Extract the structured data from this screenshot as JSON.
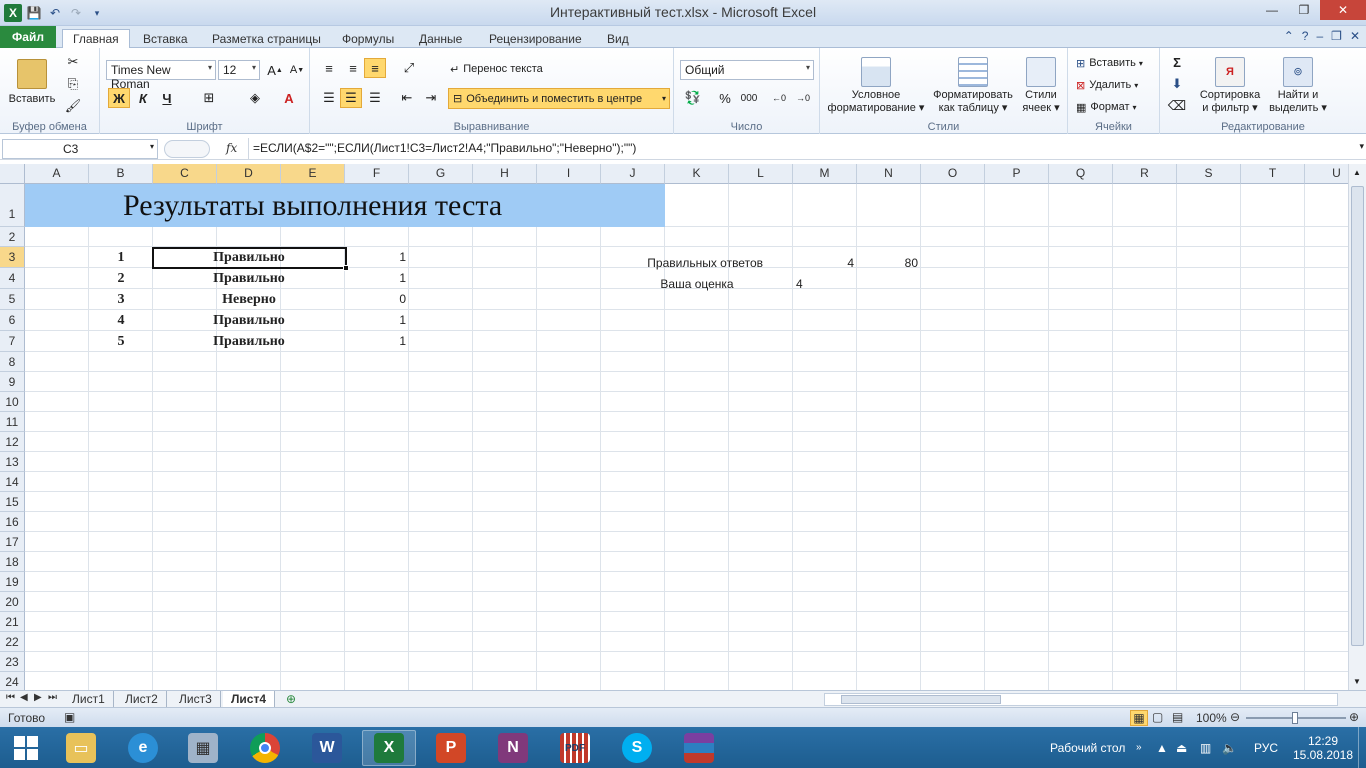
{
  "window": {
    "title": "Интерактивный тест.xlsx  -  Microsoft Excel",
    "app_icon": "X",
    "controls": {
      "min": "—",
      "max": "❐",
      "close": "✕"
    }
  },
  "ribbon_tabs": [
    "Файл",
    "Главная",
    "Вставка",
    "Разметка страницы",
    "Формулы",
    "Данные",
    "Рецензирование",
    "Вид"
  ],
  "ribbon": {
    "clipboard": {
      "paste": "Вставить",
      "label": "Буфер обмена"
    },
    "font": {
      "name": "Times New Roman",
      "size": "12",
      "bold": "Ж",
      "italic": "К",
      "underline": "Ч",
      "label": "Шрифт"
    },
    "alignment": {
      "wrap": "Перенос текста",
      "merge": "Объединить и поместить в центре",
      "label": "Выравнивание"
    },
    "number": {
      "format": "Общий",
      "percent": "%",
      "thousands": "000",
      "label": "Число"
    },
    "styles": {
      "conditional": [
        "Условное",
        "форматирование ▾"
      ],
      "as_table": [
        "Форматировать",
        "как таблицу ▾"
      ],
      "cell_styles": [
        "Стили",
        "ячеек ▾"
      ],
      "label": "Стили"
    },
    "cells": {
      "insert": "Вставить",
      "delete": "Удалить",
      "format": "Формат",
      "label": "Ячейки"
    },
    "editing": {
      "sort": [
        "Сортировка",
        "и фильтр ▾"
      ],
      "find": [
        "Найти и",
        "выделить ▾"
      ],
      "label": "Редактирование"
    }
  },
  "formula_bar": {
    "name_box": "C3",
    "fx": "fx",
    "formula": "=ЕСЛИ(A$2=\"\";ЕСЛИ(Лист1!C3=Лист2!A4;\"Правильно\";\"Неверно\");\"\")"
  },
  "columns": [
    "A",
    "B",
    "C",
    "D",
    "E",
    "F",
    "G",
    "H",
    "I",
    "J",
    "K",
    "L",
    "M",
    "N",
    "O",
    "P",
    "Q",
    "R",
    "S",
    "T",
    "U"
  ],
  "rows": [
    "1",
    "2",
    "3",
    "4",
    "5",
    "6",
    "7",
    "8",
    "9",
    "10",
    "11",
    "12",
    "13",
    "14",
    "15",
    "16",
    "17",
    "18",
    "19",
    "20",
    "21",
    "22",
    "23",
    "24"
  ],
  "sheet": {
    "banner": "Результаты выполнения теста",
    "results": [
      {
        "n": "1",
        "answer": "Правильно",
        "score": "1"
      },
      {
        "n": "2",
        "answer": "Правильно",
        "score": "1"
      },
      {
        "n": "3",
        "answer": "Неверно",
        "score": "0"
      },
      {
        "n": "4",
        "answer": "Правильно",
        "score": "1"
      },
      {
        "n": "5",
        "answer": "Правильно",
        "score": "1"
      }
    ],
    "correct_label": "Правильных ответов",
    "correct_count": "4",
    "correct_percent": "80",
    "grade_label": "Ваша оценка",
    "grade": "4"
  },
  "sheet_tabs": [
    "Лист1",
    "Лист2",
    "Лист3",
    "Лист4"
  ],
  "active_sheet": "Лист4",
  "status": {
    "ready": "Готово",
    "zoom": "100%"
  },
  "taskbar": {
    "desktop": "Рабочий стол",
    "lang": "РУС",
    "time": "12:29",
    "date": "15.08.2018"
  }
}
